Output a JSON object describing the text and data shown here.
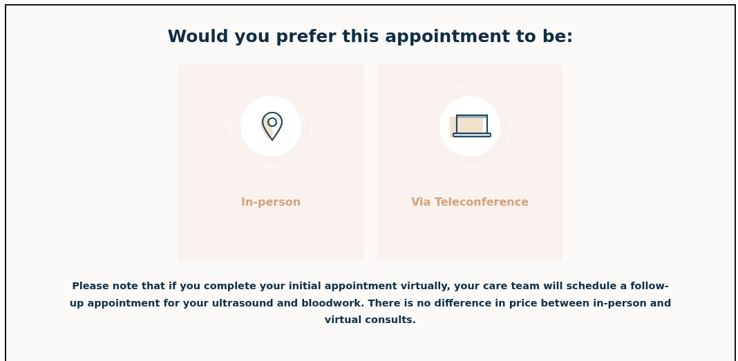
{
  "title": "Would you prefer this appointment to be:",
  "options": [
    {
      "kind": "location",
      "label": "In-person"
    },
    {
      "kind": "laptop",
      "label": "Via Teleconference"
    }
  ],
  "note": "Please note that if you complete your initial appointment virtually, your care team will schedule a follow-up appointment for your ultrasound and bloodwork. There is no difference in price between in-person and virtual consults."
}
